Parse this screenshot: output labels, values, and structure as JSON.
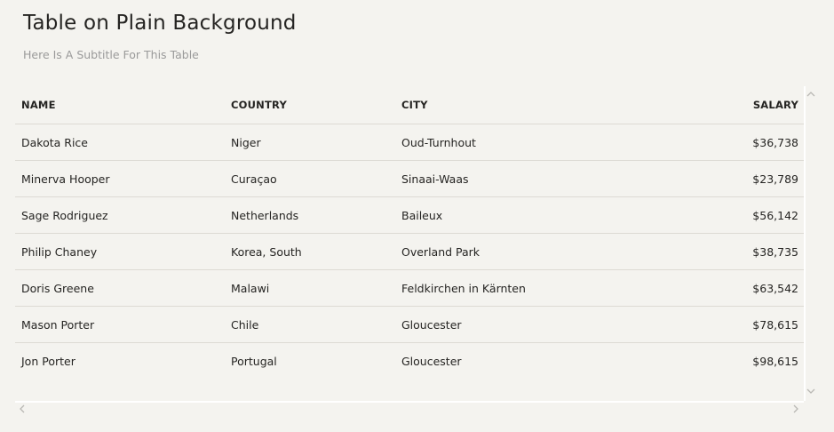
{
  "card": {
    "title": "Table on Plain Background",
    "subtitle": "Here Is A Subtitle For This Table"
  },
  "table": {
    "headers": {
      "name": "NAME",
      "country": "COUNTRY",
      "city": "CITY",
      "salary": "SALARY"
    },
    "rows": [
      {
        "name": "Dakota Rice",
        "country": "Niger",
        "city": "Oud-Turnhout",
        "salary": "$36,738"
      },
      {
        "name": "Minerva Hooper",
        "country": "Curaçao",
        "city": "Sinaai-Waas",
        "salary": "$23,789"
      },
      {
        "name": "Sage Rodriguez",
        "country": "Netherlands",
        "city": "Baileux",
        "salary": "$56,142"
      },
      {
        "name": "Philip Chaney",
        "country": "Korea, South",
        "city": "Overland Park",
        "salary": "$38,735"
      },
      {
        "name": "Doris Greene",
        "country": "Malawi",
        "city": "Feldkirchen in Kärnten",
        "salary": "$63,542"
      },
      {
        "name": "Mason Porter",
        "country": "Chile",
        "city": "Gloucester",
        "salary": "$78,615"
      },
      {
        "name": "Jon Porter",
        "country": "Portugal",
        "city": "Gloucester",
        "salary": "$98,615"
      }
    ]
  },
  "scrollbars": {
    "up_icon": "chevron-up-icon",
    "down_icon": "chevron-down-icon",
    "left_icon": "chevron-left-icon",
    "right_icon": "chevron-right-icon"
  },
  "colors": {
    "background": "#f4f3ef",
    "text": "#252422",
    "subtitle": "#9a9a9a",
    "divider": "#dcdad4"
  }
}
